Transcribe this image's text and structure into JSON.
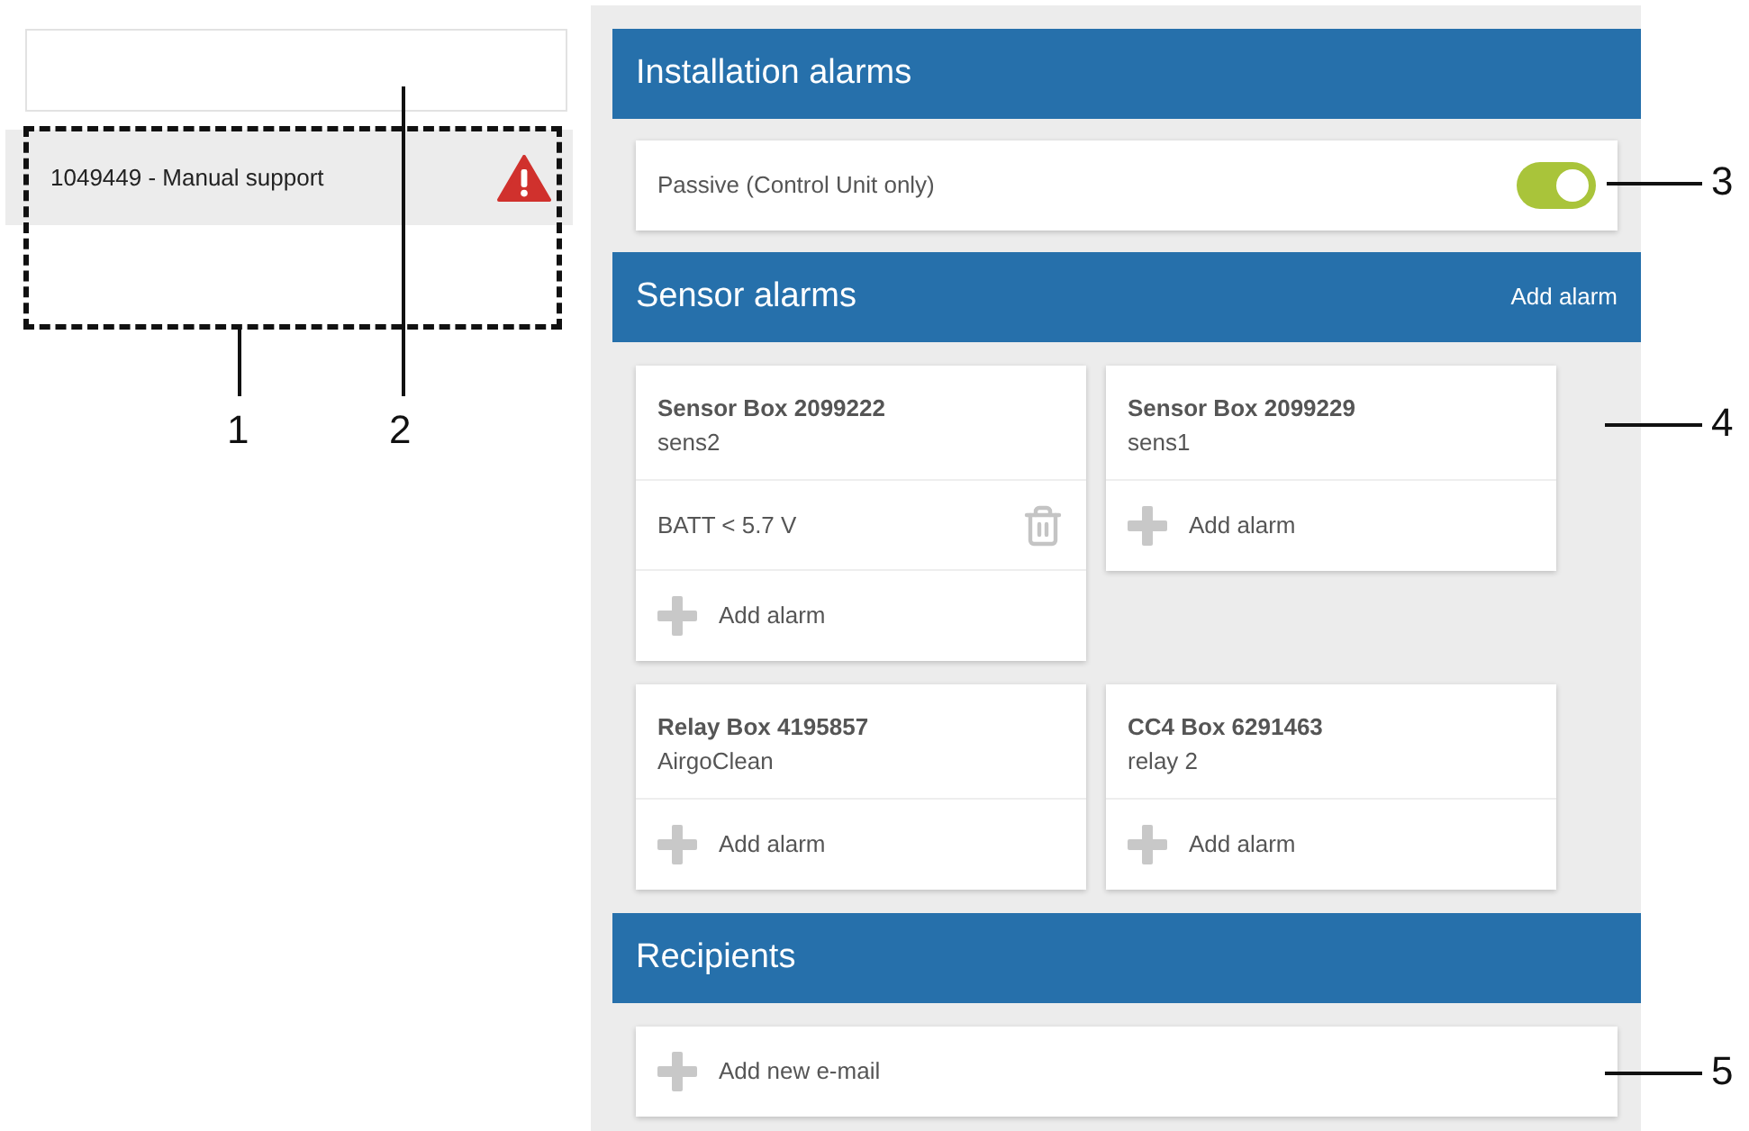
{
  "sidebar": {
    "items": [
      {
        "label": "1049449 - Manual support",
        "selected": true,
        "warning": true
      }
    ]
  },
  "installation_alarms": {
    "title": "Installation alarms",
    "options": [
      {
        "label": "Passive (Control Unit only)",
        "on": true
      }
    ]
  },
  "sensor_alarms": {
    "title": "Sensor alarms",
    "action": "Add alarm",
    "boxes": [
      {
        "title": "Sensor Box 2099222",
        "subtitle": "sens2",
        "alarms": [
          {
            "label": "BATT < 5.7 V"
          }
        ],
        "add_label": "Add alarm"
      },
      {
        "title": "Sensor Box 2099229",
        "subtitle": "sens1",
        "add_label": "Add alarm"
      },
      {
        "title": "Relay Box 4195857",
        "subtitle": "AirgoClean",
        "add_label": "Add alarm"
      },
      {
        "title": "CC4 Box 6291463",
        "subtitle": "relay 2",
        "add_label": "Add alarm"
      }
    ]
  },
  "recipients": {
    "title": "Recipients",
    "add_label": "Add new e-mail"
  },
  "callouts": [
    {
      "label": "1"
    },
    {
      "label": "2"
    },
    {
      "label": "3"
    },
    {
      "label": "4"
    },
    {
      "label": "5"
    }
  ]
}
